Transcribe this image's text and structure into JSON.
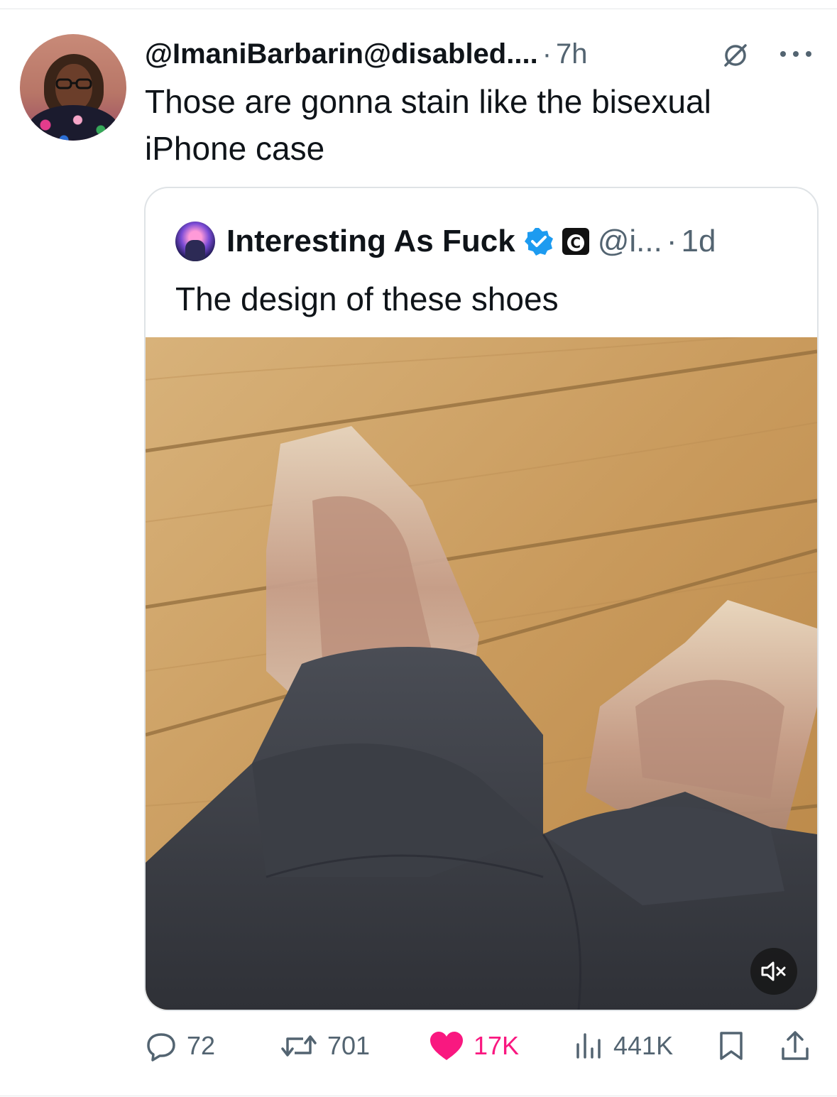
{
  "reply": {
    "handle": "@ImaniBarbarin@disabled....",
    "separator": "·",
    "time": "7h",
    "text": "Those are gonna stain like the bisexual iPhone case"
  },
  "quoted": {
    "name": "Interesting As Fuck",
    "badge_letter": "C",
    "handle": "@i...",
    "separator": "·",
    "time": "1d",
    "text": "The design of these shoes",
    "media": {
      "type": "video",
      "muted": true
    }
  },
  "actions": {
    "replies": "72",
    "reposts": "701",
    "likes": "17K",
    "views": "441K"
  },
  "colors": {
    "secondary_text": "#536471",
    "like_active": "#f91880",
    "verified": "#1d9bf0",
    "border": "#dfe3e6"
  },
  "icons": [
    "no-sign-icon",
    "more-icon",
    "verified-icon",
    "mute-icon",
    "reply-icon",
    "repost-icon",
    "like-icon",
    "views-icon",
    "bookmark-icon",
    "share-icon"
  ]
}
